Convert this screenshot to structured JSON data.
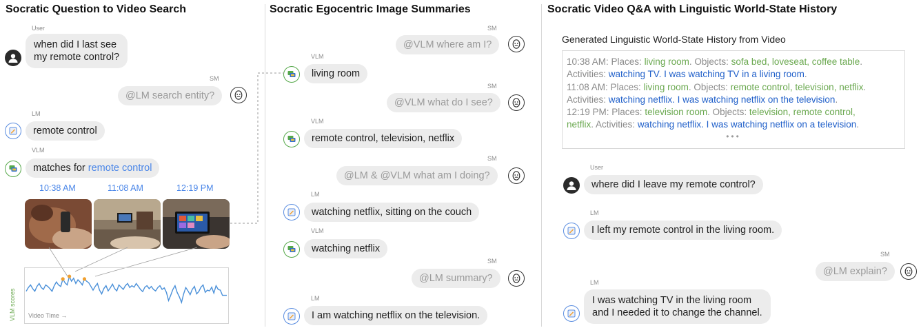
{
  "titles": {
    "left": "Socratic Question to Video Search",
    "middle": "Socratic Egocentric Image Summaries",
    "right": "Socratic Video Q&A with Linguistic World-State History"
  },
  "speakers": {
    "user": "User",
    "lm": "LM",
    "vlm": "VLM",
    "sm": "SM"
  },
  "icons": {
    "user": "user-avatar-icon",
    "lm": "notepad-icon",
    "vlm": "chat-image-icon",
    "sm": "robot-face-icon"
  },
  "colors": {
    "highlight": "#4a86e8",
    "places_objects": "#6aa84f",
    "activities": "#1f5fc9",
    "score_line": "#4a90d9",
    "peak": "#f0a030"
  },
  "left": {
    "q_line1": "when did I last see",
    "q_line2": "my remote control?",
    "sm_msg": "@LM search entity?",
    "lm_msg": "remote control",
    "vlm_prefix": "matches for ",
    "vlm_highlight": "remote control",
    "times": [
      "10:38 AM",
      "11:08 AM",
      "12:19 PM"
    ],
    "plot_ylabel": "VLM scores",
    "plot_xlabel": "Video Time →"
  },
  "middle": {
    "m1": "@VLM where am I?",
    "m2": "living room",
    "m3": "@VLM what do I see?",
    "m4": "remote control, television, netflix",
    "m5": "@LM & @VLM what am I doing?",
    "m6": "watching netflix, sitting on the couch",
    "m7": "watching netflix",
    "m8": "@LM summary?",
    "m9": "I am watching netflix on the television."
  },
  "right": {
    "history_title": "Generated Linguistic World-State History from Video",
    "h": {
      "t1": "10:38 AM: Places: ",
      "p1": "living room",
      "o_label1": ". Objects: ",
      "o1": "sofa bed, loveseat, coffee table",
      "dot1": ".",
      "a_label1": "Activities: ",
      "a1": "watching TV. I was watching TV in a living room",
      "dot2": ".",
      "t2": "11:08 AM: Places: ",
      "p2": "living room",
      "o_label2": ". Objects: ",
      "o2": "remote control, television, netflix",
      "dot3": ".",
      "a_label2": "Activities: ",
      "a2": "watching netflix. I was watching netflix on the television",
      "dot4": ".",
      "t3": "12:19 PM: Places: ",
      "p3": "television room",
      "o_label3": ". Objects: ",
      "o3a": "television, remote control,",
      "o3b": "netflix",
      "a_label3": ". Activities: ",
      "a3": "watching netflix. I was watching netflix on a television",
      "dot5": ".",
      "more": "•••"
    },
    "q": "where did I leave my remote control?",
    "lm1": "I left my remote control in the living room.",
    "sm_msg": "@LM explain?",
    "lm2_line1": "I was watching TV in the living room",
    "lm2_line2": "and I needed it to change the channel."
  },
  "chart_data": {
    "type": "line",
    "title": "",
    "xlabel": "Video Time →",
    "ylabel": "VLM scores",
    "series": [
      {
        "values": [
          0.45,
          0.55,
          0.62,
          0.52,
          0.45,
          0.58,
          0.66,
          0.55,
          0.5,
          0.62,
          0.58,
          0.52,
          0.45,
          0.6,
          0.7,
          0.62,
          0.58,
          0.78,
          0.68,
          0.62,
          0.85,
          0.72,
          0.8,
          0.66,
          0.76,
          0.7,
          0.62,
          0.78,
          0.72,
          0.68,
          0.58,
          0.48,
          0.58,
          0.66,
          0.48,
          0.38,
          0.52,
          0.6,
          0.46,
          0.54,
          0.64,
          0.52,
          0.46,
          0.62,
          0.56,
          0.5,
          0.6,
          0.66,
          0.55,
          0.6,
          0.56,
          0.66,
          0.58,
          0.5,
          0.44,
          0.56,
          0.6,
          0.52,
          0.58,
          0.5,
          0.46,
          0.55,
          0.6,
          0.5,
          0.54,
          0.42,
          0.2,
          0.34,
          0.5,
          0.6,
          0.42,
          0.3,
          0.15,
          0.38,
          0.55,
          0.46,
          0.36,
          0.5,
          0.58,
          0.38,
          0.44,
          0.56,
          0.62,
          0.42,
          0.48,
          0.46,
          0.56,
          0.4,
          0.6,
          0.5,
          0.48,
          0.34,
          0.34,
          0.34
        ]
      }
    ],
    "highlights": [
      17,
      20,
      27
    ]
  }
}
